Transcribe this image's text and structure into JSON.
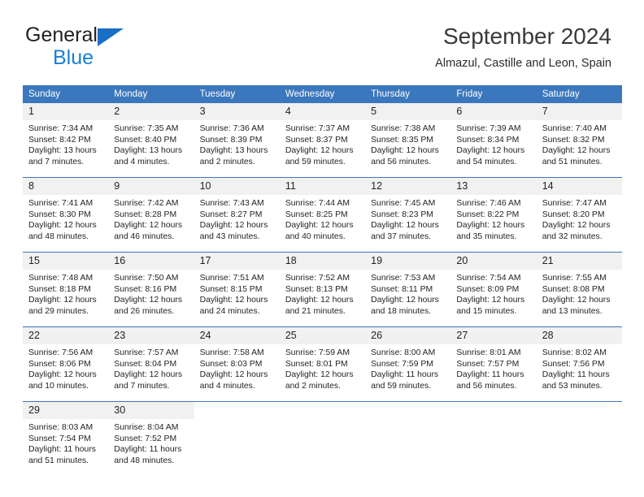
{
  "brand": {
    "name_part1": "General",
    "name_part2": "Blue",
    "triangle_color": "#1a6fc4",
    "blue_text_color": "#1a7fd4"
  },
  "header": {
    "month_title": "September 2024",
    "location": "Almazul, Castille and Leon, Spain"
  },
  "theme": {
    "header_blue": "#3b77bc",
    "daynum_band": "#f1f1f1",
    "text": "#231f20"
  },
  "weekday_headers": [
    "Sunday",
    "Monday",
    "Tuesday",
    "Wednesday",
    "Thursday",
    "Friday",
    "Saturday"
  ],
  "weeks": [
    [
      {
        "day": "1",
        "sunrise": "Sunrise: 7:34 AM",
        "sunset": "Sunset: 8:42 PM",
        "daylight_line1": "Daylight: 13 hours",
        "daylight_line2": "and 7 minutes."
      },
      {
        "day": "2",
        "sunrise": "Sunrise: 7:35 AM",
        "sunset": "Sunset: 8:40 PM",
        "daylight_line1": "Daylight: 13 hours",
        "daylight_line2": "and 4 minutes."
      },
      {
        "day": "3",
        "sunrise": "Sunrise: 7:36 AM",
        "sunset": "Sunset: 8:39 PM",
        "daylight_line1": "Daylight: 13 hours",
        "daylight_line2": "and 2 minutes."
      },
      {
        "day": "4",
        "sunrise": "Sunrise: 7:37 AM",
        "sunset": "Sunset: 8:37 PM",
        "daylight_line1": "Daylight: 12 hours",
        "daylight_line2": "and 59 minutes."
      },
      {
        "day": "5",
        "sunrise": "Sunrise: 7:38 AM",
        "sunset": "Sunset: 8:35 PM",
        "daylight_line1": "Daylight: 12 hours",
        "daylight_line2": "and 56 minutes."
      },
      {
        "day": "6",
        "sunrise": "Sunrise: 7:39 AM",
        "sunset": "Sunset: 8:34 PM",
        "daylight_line1": "Daylight: 12 hours",
        "daylight_line2": "and 54 minutes."
      },
      {
        "day": "7",
        "sunrise": "Sunrise: 7:40 AM",
        "sunset": "Sunset: 8:32 PM",
        "daylight_line1": "Daylight: 12 hours",
        "daylight_line2": "and 51 minutes."
      }
    ],
    [
      {
        "day": "8",
        "sunrise": "Sunrise: 7:41 AM",
        "sunset": "Sunset: 8:30 PM",
        "daylight_line1": "Daylight: 12 hours",
        "daylight_line2": "and 48 minutes."
      },
      {
        "day": "9",
        "sunrise": "Sunrise: 7:42 AM",
        "sunset": "Sunset: 8:28 PM",
        "daylight_line1": "Daylight: 12 hours",
        "daylight_line2": "and 46 minutes."
      },
      {
        "day": "10",
        "sunrise": "Sunrise: 7:43 AM",
        "sunset": "Sunset: 8:27 PM",
        "daylight_line1": "Daylight: 12 hours",
        "daylight_line2": "and 43 minutes."
      },
      {
        "day": "11",
        "sunrise": "Sunrise: 7:44 AM",
        "sunset": "Sunset: 8:25 PM",
        "daylight_line1": "Daylight: 12 hours",
        "daylight_line2": "and 40 minutes."
      },
      {
        "day": "12",
        "sunrise": "Sunrise: 7:45 AM",
        "sunset": "Sunset: 8:23 PM",
        "daylight_line1": "Daylight: 12 hours",
        "daylight_line2": "and 37 minutes."
      },
      {
        "day": "13",
        "sunrise": "Sunrise: 7:46 AM",
        "sunset": "Sunset: 8:22 PM",
        "daylight_line1": "Daylight: 12 hours",
        "daylight_line2": "and 35 minutes."
      },
      {
        "day": "14",
        "sunrise": "Sunrise: 7:47 AM",
        "sunset": "Sunset: 8:20 PM",
        "daylight_line1": "Daylight: 12 hours",
        "daylight_line2": "and 32 minutes."
      }
    ],
    [
      {
        "day": "15",
        "sunrise": "Sunrise: 7:48 AM",
        "sunset": "Sunset: 8:18 PM",
        "daylight_line1": "Daylight: 12 hours",
        "daylight_line2": "and 29 minutes."
      },
      {
        "day": "16",
        "sunrise": "Sunrise: 7:50 AM",
        "sunset": "Sunset: 8:16 PM",
        "daylight_line1": "Daylight: 12 hours",
        "daylight_line2": "and 26 minutes."
      },
      {
        "day": "17",
        "sunrise": "Sunrise: 7:51 AM",
        "sunset": "Sunset: 8:15 PM",
        "daylight_line1": "Daylight: 12 hours",
        "daylight_line2": "and 24 minutes."
      },
      {
        "day": "18",
        "sunrise": "Sunrise: 7:52 AM",
        "sunset": "Sunset: 8:13 PM",
        "daylight_line1": "Daylight: 12 hours",
        "daylight_line2": "and 21 minutes."
      },
      {
        "day": "19",
        "sunrise": "Sunrise: 7:53 AM",
        "sunset": "Sunset: 8:11 PM",
        "daylight_line1": "Daylight: 12 hours",
        "daylight_line2": "and 18 minutes."
      },
      {
        "day": "20",
        "sunrise": "Sunrise: 7:54 AM",
        "sunset": "Sunset: 8:09 PM",
        "daylight_line1": "Daylight: 12 hours",
        "daylight_line2": "and 15 minutes."
      },
      {
        "day": "21",
        "sunrise": "Sunrise: 7:55 AM",
        "sunset": "Sunset: 8:08 PM",
        "daylight_line1": "Daylight: 12 hours",
        "daylight_line2": "and 13 minutes."
      }
    ],
    [
      {
        "day": "22",
        "sunrise": "Sunrise: 7:56 AM",
        "sunset": "Sunset: 8:06 PM",
        "daylight_line1": "Daylight: 12 hours",
        "daylight_line2": "and 10 minutes."
      },
      {
        "day": "23",
        "sunrise": "Sunrise: 7:57 AM",
        "sunset": "Sunset: 8:04 PM",
        "daylight_line1": "Daylight: 12 hours",
        "daylight_line2": "and 7 minutes."
      },
      {
        "day": "24",
        "sunrise": "Sunrise: 7:58 AM",
        "sunset": "Sunset: 8:03 PM",
        "daylight_line1": "Daylight: 12 hours",
        "daylight_line2": "and 4 minutes."
      },
      {
        "day": "25",
        "sunrise": "Sunrise: 7:59 AM",
        "sunset": "Sunset: 8:01 PM",
        "daylight_line1": "Daylight: 12 hours",
        "daylight_line2": "and 2 minutes."
      },
      {
        "day": "26",
        "sunrise": "Sunrise: 8:00 AM",
        "sunset": "Sunset: 7:59 PM",
        "daylight_line1": "Daylight: 11 hours",
        "daylight_line2": "and 59 minutes."
      },
      {
        "day": "27",
        "sunrise": "Sunrise: 8:01 AM",
        "sunset": "Sunset: 7:57 PM",
        "daylight_line1": "Daylight: 11 hours",
        "daylight_line2": "and 56 minutes."
      },
      {
        "day": "28",
        "sunrise": "Sunrise: 8:02 AM",
        "sunset": "Sunset: 7:56 PM",
        "daylight_line1": "Daylight: 11 hours",
        "daylight_line2": "and 53 minutes."
      }
    ],
    [
      {
        "day": "29",
        "sunrise": "Sunrise: 8:03 AM",
        "sunset": "Sunset: 7:54 PM",
        "daylight_line1": "Daylight: 11 hours",
        "daylight_line2": "and 51 minutes."
      },
      {
        "day": "30",
        "sunrise": "Sunrise: 8:04 AM",
        "sunset": "Sunset: 7:52 PM",
        "daylight_line1": "Daylight: 11 hours",
        "daylight_line2": "and 48 minutes."
      },
      {
        "day": "",
        "sunrise": "",
        "sunset": "",
        "daylight_line1": "",
        "daylight_line2": ""
      },
      {
        "day": "",
        "sunrise": "",
        "sunset": "",
        "daylight_line1": "",
        "daylight_line2": ""
      },
      {
        "day": "",
        "sunrise": "",
        "sunset": "",
        "daylight_line1": "",
        "daylight_line2": ""
      },
      {
        "day": "",
        "sunrise": "",
        "sunset": "",
        "daylight_line1": "",
        "daylight_line2": ""
      },
      {
        "day": "",
        "sunrise": "",
        "sunset": "",
        "daylight_line1": "",
        "daylight_line2": ""
      }
    ]
  ]
}
